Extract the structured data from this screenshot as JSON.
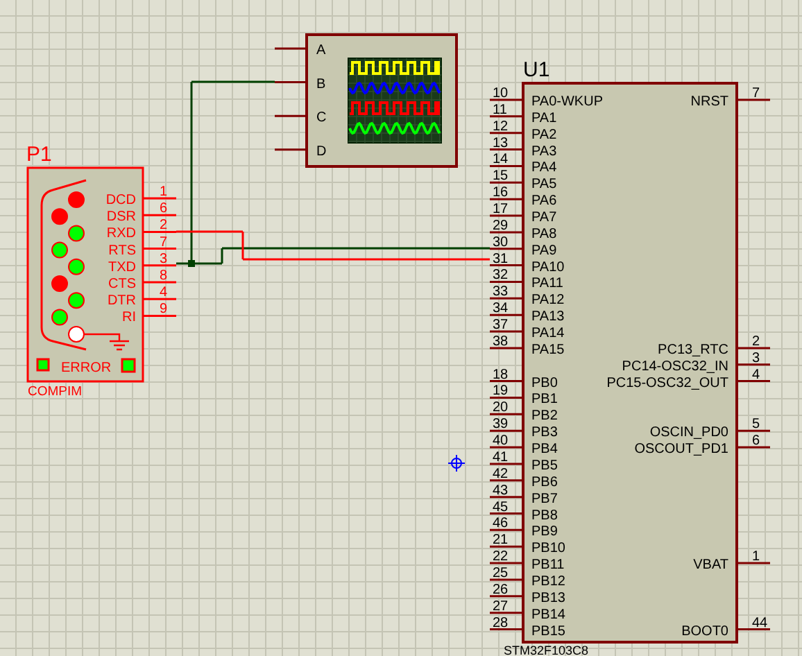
{
  "scope": {
    "channels": [
      {
        "label": "A",
        "color": "#ffff00",
        "kind": "square"
      },
      {
        "label": "B",
        "color": "#0000ff",
        "kind": "sine"
      },
      {
        "label": "C",
        "color": "#ff0000",
        "kind": "square"
      },
      {
        "label": "D",
        "color": "#00ff00",
        "kind": "sine"
      }
    ]
  },
  "p1": {
    "ref": "P1",
    "type": "COMPIM",
    "pins": [
      {
        "signal": "DCD",
        "number": "1",
        "high": false
      },
      {
        "signal": "DSR",
        "number": "6",
        "high": false
      },
      {
        "signal": "RXD",
        "number": "2",
        "high": true
      },
      {
        "signal": "RTS",
        "number": "7",
        "high": true
      },
      {
        "signal": "TXD",
        "number": "3",
        "high": true
      },
      {
        "signal": "CTS",
        "number": "8",
        "high": false
      },
      {
        "signal": "DTR",
        "number": "4",
        "high": true
      },
      {
        "signal": "RI",
        "number": "9",
        "high": true
      }
    ],
    "error": {
      "label": "ERROR",
      "active": false
    }
  },
  "u1": {
    "ref": "U1",
    "part": "STM32F103C8",
    "left_groups": [
      [
        {
          "number": "10",
          "label": "PA0-WKUP"
        },
        {
          "number": "11",
          "label": "PA1"
        },
        {
          "number": "12",
          "label": "PA2"
        },
        {
          "number": "13",
          "label": "PA3"
        },
        {
          "number": "14",
          "label": "PA4"
        },
        {
          "number": "15",
          "label": "PA5"
        },
        {
          "number": "16",
          "label": "PA6"
        },
        {
          "number": "17",
          "label": "PA7"
        },
        {
          "number": "29",
          "label": "PA8"
        },
        {
          "number": "30",
          "label": "PA9"
        },
        {
          "number": "31",
          "label": "PA10"
        },
        {
          "number": "32",
          "label": "PA11"
        },
        {
          "number": "33",
          "label": "PA12"
        },
        {
          "number": "34",
          "label": "PA13"
        },
        {
          "number": "37",
          "label": "PA14"
        },
        {
          "number": "38",
          "label": "PA15"
        }
      ],
      [
        {
          "number": "18",
          "label": "PB0"
        },
        {
          "number": "19",
          "label": "PB1"
        },
        {
          "number": "20",
          "label": "PB2"
        },
        {
          "number": "39",
          "label": "PB3"
        },
        {
          "number": "40",
          "label": "PB4"
        },
        {
          "number": "41",
          "label": "PB5"
        },
        {
          "number": "42",
          "label": "PB6"
        },
        {
          "number": "43",
          "label": "PB7"
        },
        {
          "number": "45",
          "label": "PB8"
        },
        {
          "number": "46",
          "label": "PB9"
        },
        {
          "number": "21",
          "label": "PB10"
        },
        {
          "number": "22",
          "label": "PB11"
        },
        {
          "number": "25",
          "label": "PB12"
        },
        {
          "number": "26",
          "label": "PB13"
        },
        {
          "number": "27",
          "label": "PB14"
        },
        {
          "number": "28",
          "label": "PB15"
        }
      ]
    ],
    "right_groups": [
      [
        {
          "number": "7",
          "label": "NRST"
        }
      ],
      [
        {
          "number": "2",
          "label": "PC13_RTC"
        },
        {
          "number": "3",
          "label": "PC14-OSC32_IN"
        },
        {
          "number": "4",
          "label": "PC15-OSC32_OUT"
        }
      ],
      [
        {
          "number": "5",
          "label": "OSCIN_PD0"
        },
        {
          "number": "6",
          "label": "OSCOUT_PD1"
        }
      ],
      [
        {
          "number": "1",
          "label": "VBAT"
        }
      ],
      [
        {
          "number": "44",
          "label": "BOOT0"
        }
      ]
    ]
  }
}
